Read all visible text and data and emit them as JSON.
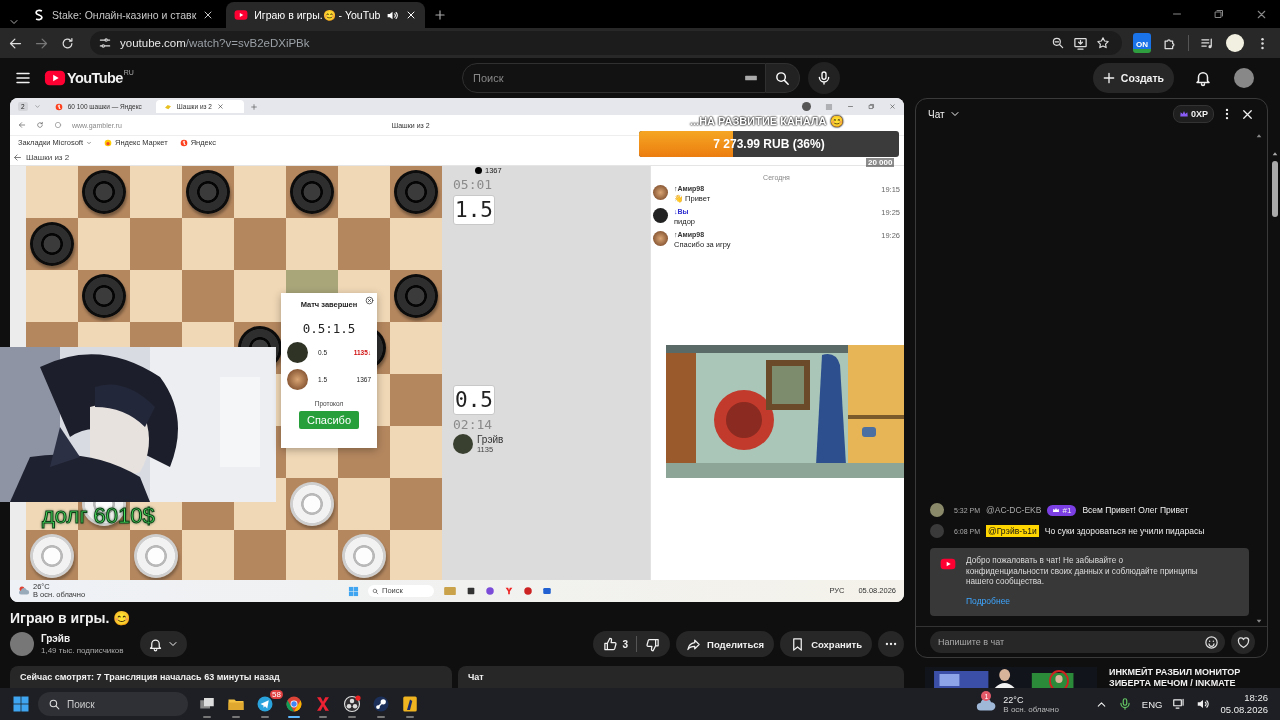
{
  "browser": {
    "tabs": [
      {
        "title": "Stake: Онлайн-казино и ставк",
        "kind": "stake",
        "selected": false,
        "audio": false
      },
      {
        "title": "Играю в игры.😊 - YouTub",
        "kind": "youtube",
        "selected": true,
        "audio": true
      }
    ],
    "url": {
      "host": "youtube.com",
      "path": "/watch?v=svB2eDXiPBk"
    },
    "extension_badge": "ON"
  },
  "masthead": {
    "logo": "YouTube",
    "region": "RU",
    "search_placeholder": "Поиск",
    "create": "Создать"
  },
  "stream": {
    "tab_count": "2",
    "tabs": [
      {
        "title": "60 100 шашки — Яндекс",
        "kind": "yandex",
        "selected": false
      },
      {
        "title": "Шашки из 2",
        "kind": "game",
        "selected": true
      }
    ],
    "url": "www.gambler.ru",
    "page_title": "Шашки из 2",
    "bookmarks": [
      {
        "title": "Закладки Microsoft",
        "kind": "folder"
      },
      {
        "title": "Яндекс Маркет",
        "kind": "market"
      },
      {
        "title": "Яндекс",
        "kind": "yandex"
      }
    ],
    "back_label": "Шашки из 2",
    "board": {
      "rows": [
        [
          {
            "kind": "empty"
          },
          {
            "kind": "black"
          },
          {
            "kind": "empty"
          },
          {
            "kind": "black"
          },
          {
            "kind": "empty"
          },
          {
            "kind": "black"
          },
          {
            "kind": "empty"
          },
          {
            "kind": "black"
          }
        ],
        [
          {
            "kind": "black"
          },
          {
            "kind": "empty"
          },
          {
            "kind": "empty"
          },
          {
            "kind": "empty"
          },
          {
            "kind": "empty"
          },
          {
            "kind": "empty"
          },
          {
            "kind": "empty"
          },
          {
            "kind": "empty"
          }
        ],
        [
          {
            "kind": "empty"
          },
          {
            "kind": "black"
          },
          {
            "kind": "empty"
          },
          {
            "kind": "empty"
          },
          {
            "kind": "empty"
          },
          {
            "kind": "marked"
          },
          {
            "kind": "empty"
          },
          {
            "kind": "black"
          }
        ],
        [
          {
            "kind": "empty"
          },
          {
            "kind": "empty"
          },
          {
            "kind": "empty"
          },
          {
            "kind": "empty"
          },
          {
            "kind": "black"
          },
          {
            "kind": "empty"
          },
          {
            "kind": "black"
          },
          {
            "kind": "empty"
          }
        ],
        [
          {
            "kind": "empty"
          },
          {
            "kind": "empty"
          },
          {
            "kind": "empty"
          },
          {
            "kind": "empty"
          },
          {
            "kind": "empty"
          },
          {
            "kind": "empty"
          },
          {
            "kind": "empty"
          },
          {
            "kind": "empty"
          }
        ],
        [
          {
            "kind": "empty"
          },
          {
            "kind": "empty"
          },
          {
            "kind": "empty"
          },
          {
            "kind": "empty"
          },
          {
            "kind": "empty"
          },
          {
            "kind": "empty"
          },
          {
            "kind": "empty"
          },
          {
            "kind": "empty"
          }
        ],
        [
          {
            "kind": "empty"
          },
          {
            "kind": "white"
          },
          {
            "kind": "empty"
          },
          {
            "kind": "empty"
          },
          {
            "kind": "empty"
          },
          {
            "kind": "white"
          },
          {
            "kind": "empty"
          },
          {
            "kind": "empty"
          }
        ],
        [
          {
            "kind": "white"
          },
          {
            "kind": "empty"
          },
          {
            "kind": "white"
          },
          {
            "kind": "empty"
          },
          {
            "kind": "empty"
          },
          {
            "kind": "empty"
          },
          {
            "kind": "white"
          },
          {
            "kind": "empty"
          }
        ]
      ]
    },
    "opponent": {
      "rating": "1367",
      "clock": "05:01",
      "score": "1.5"
    },
    "player": {
      "score": "0.5",
      "clock": "02:14",
      "name": "Грэйв",
      "rating": "1135"
    },
    "result": {
      "title": "Матч завершен",
      "score": "0.5:1.5",
      "rows": [
        {
          "points": "0.5",
          "rating": "1135↓",
          "dropped": true
        },
        {
          "points": "1.5",
          "rating": "1367",
          "dropped": false
        }
      ],
      "protocol": "Протокол",
      "button": "Спасибо"
    },
    "game_chat": {
      "day": "Сегодня",
      "messages": [
        {
          "author": "↑Амир98",
          "me": false,
          "time": "19:15",
          "text": "👋 Привет"
        },
        {
          "author": "↓Вы",
          "me": true,
          "time": "19:25",
          "text": "пидор"
        },
        {
          "author": "↑Амир98",
          "me": false,
          "time": "19:26",
          "text": "Спасибо за игру"
        }
      ]
    },
    "donation": {
      "title": "...НА РАЗВИТИЕ КАНАЛА 😊",
      "amount": "7 273.99 RUB (36%)",
      "level": 0.36,
      "goal": "20 000"
    },
    "overlay_text": "долг 6010$",
    "taskbar": {
      "temp": "26°C",
      "summary": "В осн. облачно",
      "search": "Поиск",
      "language": "РУС",
      "date": "05.08.2026"
    }
  },
  "video": {
    "title": "Играю в игры. 😊",
    "channel": "Грэйв",
    "subscribers": "1,49 тыс. подписчиков",
    "likes": "3",
    "share": "Поделиться",
    "save": "Сохранить",
    "description": "Сейчас смотрят: 7  Трансляция началась 63 минуты назад",
    "chat_box": "Чат"
  },
  "chat": {
    "title": "Чат",
    "xp": "0XP",
    "messages": [
      {
        "time": "5:32 PM",
        "author": "@AC-DC-EKB",
        "owner": false,
        "badge": "#1",
        "text": "Всем Привет! Олег Привет"
      },
      {
        "time": "6:08 PM",
        "author": "@Грэйв-ъ1и",
        "owner": true,
        "text": "Чо суки здороваться не учили пидарасы"
      }
    ],
    "notice": {
      "text": "Добро пожаловать в чат! Не забывайте о конфиденциальности своих данных и соблюдайте принципы нашего сообщества.",
      "link": "Подробнее"
    },
    "input_placeholder": "Напишите в чат"
  },
  "recommended": {
    "title": "ИНКМЕЙТ РАЗБИЛ МОНИТОР ЗИБЕРТА МЕЧОМ / INKMATE"
  },
  "taskbar": {
    "search_placeholder": "Поиск",
    "apps": [
      {
        "kind": "taskview",
        "active": false
      },
      {
        "kind": "folder",
        "active": false
      },
      {
        "kind": "telegram",
        "active": false,
        "badge": "58"
      },
      {
        "kind": "chrome",
        "active": true
      },
      {
        "kind": "redapp",
        "active": false
      },
      {
        "kind": "obs",
        "active": false
      },
      {
        "kind": "steam",
        "active": false
      },
      {
        "kind": "yellowapp",
        "active": false
      }
    ],
    "weather": {
      "badge": "1",
      "temp": "22°C",
      "summary": "В осн. облачно"
    },
    "language": "ENG",
    "time": "18:26",
    "date": "05.08.2026"
  }
}
